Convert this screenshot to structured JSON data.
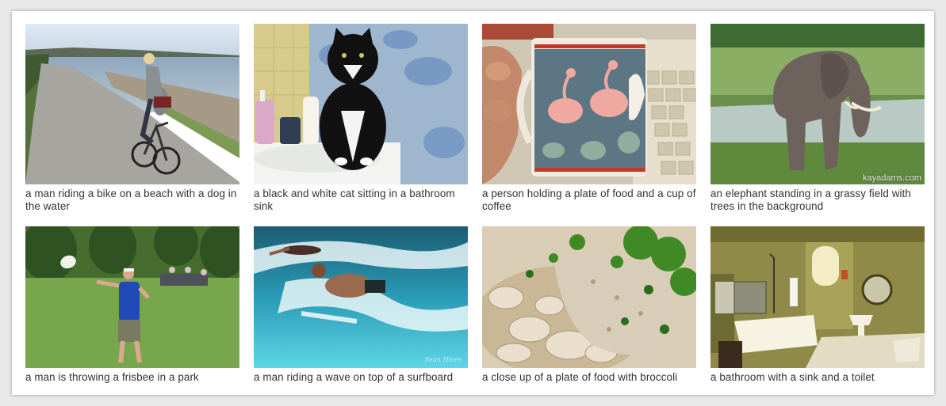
{
  "gallery": {
    "items": [
      {
        "caption": "a man riding a bike on a beach with a dog in the water"
      },
      {
        "caption": "a black and white cat sitting in a bathroom sink"
      },
      {
        "caption": "a person holding a plate of food and a cup of coffee"
      },
      {
        "caption": "an elephant standing in a grassy field with trees in the background",
        "watermark": "kayadams.com"
      },
      {
        "caption": "a man is throwing a frisbee in a park"
      },
      {
        "caption": "a man riding a wave on top of a surfboard",
        "watermark": "Sean Hines"
      },
      {
        "caption": "a close up of a plate of food with broccoli"
      },
      {
        "caption": "a bathroom with a sink and a toilet"
      }
    ]
  }
}
